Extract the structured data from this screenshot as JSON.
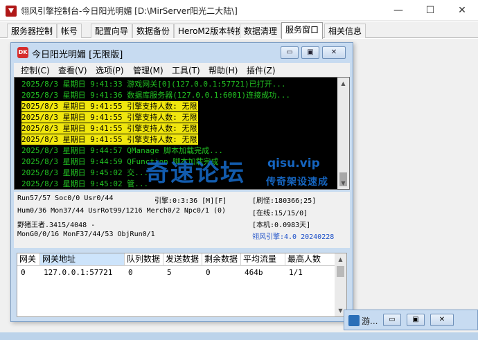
{
  "window": {
    "title": "翎风引擎控制台-今日阳光明媚 [D:\\MirServer阳光二大陆\\]",
    "minimize_glyph": "—",
    "maximize_glyph": "☐",
    "close_glyph": "✕"
  },
  "tabs": [
    {
      "label": "服务器控制"
    },
    {
      "label": "帐号"
    },
    {
      "label": "配置向导"
    },
    {
      "label": "数据备份"
    },
    {
      "label": "HeroM2版本转换"
    },
    {
      "label": "数据清理"
    },
    {
      "label": "服务窗口"
    },
    {
      "label": "相关信息"
    }
  ],
  "mdi": {
    "icon_text": "DK",
    "title": "今日阳光明媚 [无限版]",
    "min_glyph": "▭",
    "max_glyph": "▣",
    "close_glyph": "✕"
  },
  "menu": [
    {
      "label": "控制(C)"
    },
    {
      "label": "查看(V)"
    },
    {
      "label": "选项(P)"
    },
    {
      "label": "管理(M)"
    },
    {
      "label": "工具(T)"
    },
    {
      "label": "帮助(H)"
    },
    {
      "label": "插件(Z)"
    }
  ],
  "log": [
    {
      "text": "2025/8/3 星期日 9:41:33 游戏网关[0](127.0.0.1:57721)已打开...",
      "highlight": false
    },
    {
      "text": "2025/8/3 星期日 9:41:36 数据库服务器(127.0.0.1:6001)连接成功...",
      "highlight": false
    },
    {
      "text": "2025/8/3 星期日 9:41:55 引擎支持人数: 无限",
      "highlight": true
    },
    {
      "text": "2025/8/3 星期日 9:41:55 引擎支持人数: 无限",
      "highlight": true
    },
    {
      "text": "2025/8/3 星期日 9:41:55 引擎支持人数: 无限",
      "highlight": true
    },
    {
      "text": "2025/8/3 星期日 9:41:55 引擎支持人数: 无限",
      "highlight": true
    },
    {
      "text": "2025/8/3 星期日 9:44:57 QManage 脚本加载完成...",
      "highlight": false
    },
    {
      "text": "2025/8/3 星期日 9:44:59 QFunction 脚本加载完成",
      "highlight": false
    },
    {
      "text": "2025/8/3 星期日 9:45:02 交...",
      "highlight": false
    },
    {
      "text": "2025/8/3 星期日 9:45:02 管...",
      "highlight": false
    }
  ],
  "scroll": {
    "up": "▲",
    "down": "▼"
  },
  "watermark": {
    "cn": "奇速论坛",
    "url": "qisu.vip",
    "slogan": "传奇架设速成"
  },
  "status": {
    "run": "Run57/57 Soc0/0 Usr0/44",
    "engine": "引擎:0:3:36 [M][F]",
    "refresh": "[刷怪:180366;25]",
    "hum": "Hum0/36 Mon37/44 UsrRot99/1216 Merch0/2 Npc0/1 (0)",
    "online": "[在线:15/15/0]",
    "wild": "野猪王者.3415/4048 -",
    "local": "[本机:0.0983天]",
    "mon": "MonG0/0/16 MonF37/44/53 ObjRun0/1",
    "version": "翎风引擎:4.0 20240228"
  },
  "gateway": {
    "headers": [
      "网关",
      "网关地址",
      "队列数据",
      "发送数据",
      "剩余数据",
      "平均流量",
      "最高人数"
    ],
    "rows": [
      [
        "0",
        "127.0.0.1:57721",
        "0",
        "5",
        "0",
        "464b",
        "1/1"
      ]
    ]
  },
  "minimized": {
    "label": "游...",
    "btn1": "▭",
    "btn2": "▣",
    "btn3": "✕"
  }
}
